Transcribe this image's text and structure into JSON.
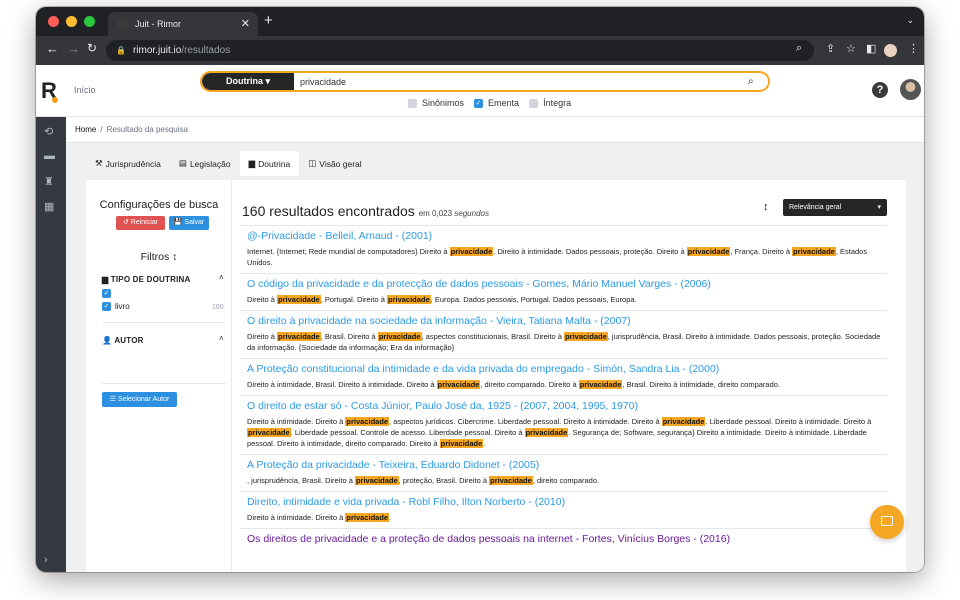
{
  "browser": {
    "tab_title": "Juit - Rimor",
    "tab_close": "✕",
    "new_tab": "+",
    "url_host": "rimor.juit.io",
    "url_path": "/resultados"
  },
  "header": {
    "logo": "R",
    "inicio": "Início",
    "search_category": "Doutrina ▾",
    "search_value": "privacidade",
    "options": [
      {
        "label": "Sinônimos",
        "checked": false
      },
      {
        "label": "Ementa",
        "checked": true
      },
      {
        "label": "Íntegra",
        "checked": false
      }
    ],
    "help": "?"
  },
  "breadcrumb": {
    "home": "Home",
    "sep": "/",
    "current": "Resultado da pesquisa"
  },
  "tabs": [
    {
      "label": "Jurisprudência",
      "icon": "gavel-icon"
    },
    {
      "label": "Legislação",
      "icon": "document-icon"
    },
    {
      "label": "Doutrina",
      "icon": "book-icon",
      "active": true
    },
    {
      "label": "Visão geral",
      "icon": "columns-icon"
    }
  ],
  "sidebar": {
    "config_title": "Configurações de busca",
    "reset_label": "↺ Reiniciar",
    "save_label": "💾 Salvar",
    "filters_title": "Filtros",
    "filters_icon": "↕",
    "type_title": "TIPO DE DOUTRINA",
    "type_option": "livro",
    "type_count": "160",
    "author_title": "AUTOR",
    "author_button": "☰ Selecionar Autor"
  },
  "results": {
    "count_label": "160 resultados encontrados",
    "time_prefix": "em 0,023",
    "time_suffix": "segundos",
    "sort_label": "Relevância geral",
    "highlight": "privacidade",
    "items": [
      {
        "title": "@-Privacidade - Belleil, Arnaud - (2001)",
        "desc": "Internet. {Internet; Rede mundial de computadores} Direito à privacidade. Direito à intimidade. Dados pessoais, proteção. Direito à privacidade, França. Direito à privacidade, Estados Unidos."
      },
      {
        "title": "O código da privacidade e da protecção de dados pessoais - Gomes, Mário Manuel Varges - (2006)",
        "desc": "Direito à privacidade, Portugal. Direito à privacidade, Europa. Dados pessoais, Portugal. Dados pessoais, Europa."
      },
      {
        "title": "O direito à privacidade na sociedade da informação - Vieira, Tatiana Malta - (2007)",
        "desc": "Direito à privacidade, Brasil. Direito à privacidade, aspectos constitucionais, Brasil. Direito à privacidade, jurisprudência, Brasil. Direito à intimidade. Dados pessoais, proteção. Sociedade da informação. {Sociedade da informação; Era da informação}"
      },
      {
        "title": "A Proteção constitucional da intimidade e da vida privada do empregado - Simón, Sandra Lia - (2000)",
        "desc": "Direito à intimidade, Brasil. Direito à intimidade. Direito à privacidade, direito comparado. Direito à privacidade, Brasil. Direito à intimidade, direito comparado."
      },
      {
        "title": "O direito de estar só - Costa Júnior, Paulo José da, 1925 - (2007, 2004, 1995, 1970)",
        "desc": "Direito à intimidade. Direito à privacidade, aspectos jurídicos. Cibercrime. Liberdade pessoal. Direito à intimidade. Direito à privacidade. Liberdade pessoal. Direito à intimidade. Direito à privacidade. Liberdade pessoal. Controle de acesso. Liberdade pessoal. Direito à privacidade. Segurança de; Software, segurança} Direito a intimidade. Direito à intimidade. Liberdade pessoal. Direito à intimidade, direito comparado. Direito à privacidade."
      },
      {
        "title": "A Proteção da privacidade - Teixeira, Eduardo Didonet - (2005)",
        "desc": ", jurisprudência, Brasil. Direito à privacidade, proteção, Brasil. Direito à privacidade, direito comparado."
      },
      {
        "title": "Direito, intimidade e vida privada - Robl Filho, Ilton Norberto - (2010)",
        "desc": "Direito à intimidade. Direito à privacidade."
      },
      {
        "title": "Os direitos de privacidade e a proteção de dados pessoais na internet - Fortes, Vinícius Borges - (2016)",
        "desc": "",
        "visited": true
      }
    ]
  }
}
